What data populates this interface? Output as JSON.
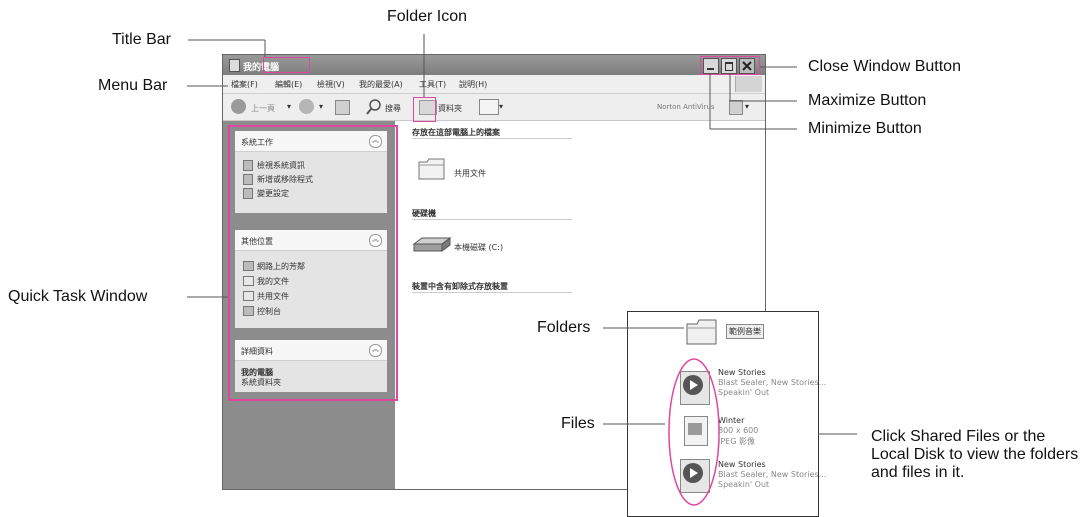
{
  "callouts": {
    "title_bar": "Title Bar",
    "menu_bar": "Menu Bar",
    "folder_icon": "Folder Icon",
    "close_button": "Close Window Button",
    "maximize_button": "Maximize Button",
    "minimize_button": "Minimize Button",
    "quick_task": "Quick Task Window",
    "folders": "Folders",
    "files": "Files",
    "click_shared": "Click Shared Files or the Local Disk to view the folders and files in it."
  },
  "window": {
    "title": "我的電腦",
    "menu": [
      "檔案(F)",
      "編輯(E)",
      "檢視(V)",
      "我的最愛(A)",
      "工具(T)",
      "說明(H)"
    ],
    "toolbar": {
      "back": "上一頁",
      "search": "搜尋",
      "folders": "資料夾",
      "norton": "Norton AntiVirus"
    },
    "tasks": {
      "system": {
        "title": "系統工作",
        "items": [
          "檢視系統資訊",
          "新增或移除程式",
          "變更設定"
        ]
      },
      "other": {
        "title": "其他位置",
        "items": [
          "網路上的芳鄰",
          "我的文件",
          "共用文件",
          "控制台"
        ]
      },
      "details": {
        "title": "詳細資料",
        "name": "我的電腦",
        "sub": "系統資料夾"
      }
    },
    "sections": {
      "stored": "存放在這部電腦上的檔案",
      "shared_docs": "共用文件",
      "hard_drives": "硬碟機",
      "local_disk": "本機磁碟 (C:)",
      "removable": "裝置中含有卸除式存放裝置"
    }
  },
  "inset": {
    "folder_label": "範例音樂",
    "files": [
      {
        "name": "New Stories",
        "line2": "Blast Sealer, New Stories...",
        "line3": "Speakin' Out"
      },
      {
        "name": "Winter",
        "line2": "800 x 600",
        "line3": "JPEG 影像"
      },
      {
        "name": "New Stories",
        "line2": "Blast Sealer, New Stories...",
        "line3": "Speakin' Out"
      }
    ]
  }
}
